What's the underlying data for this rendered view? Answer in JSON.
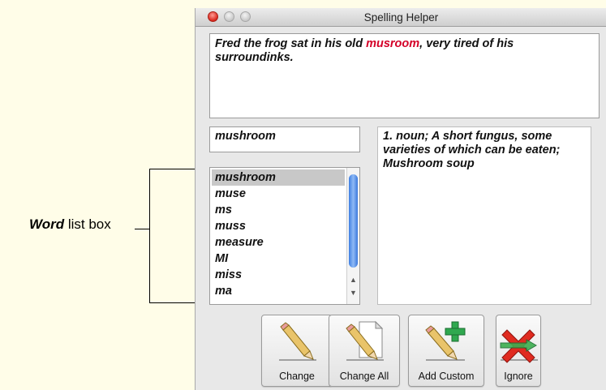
{
  "annotation": {
    "label_bold": "Word",
    "label_rest": " list box"
  },
  "window": {
    "title": "Spelling Helper"
  },
  "sentence": {
    "before": "Fred the frog sat in his old ",
    "misspelled": "musroom",
    "after": ", very tired of his surroundinks."
  },
  "word_input": {
    "value": "mushroom"
  },
  "definition": {
    "text": "1. noun; A short fungus, some varieties of which can be eaten; Mushroom soup"
  },
  "suggestions": {
    "selected": "mushroom",
    "items": [
      "mushroom",
      "muse",
      "ms",
      "muss",
      "measure",
      "MI",
      "miss",
      "ma"
    ]
  },
  "buttons": {
    "change": "Change",
    "change_all": "Change All",
    "add_custom": "Add Custom",
    "ignore": "Ignore"
  },
  "colors": {
    "misspelled": "#d40028",
    "scroll_thumb": "#3f7fe2"
  },
  "icons": {
    "change": "pencil-icon",
    "change_all": "pencil-document-icon",
    "add_custom": "pencil-plus-icon",
    "ignore": "red-x-icon"
  }
}
